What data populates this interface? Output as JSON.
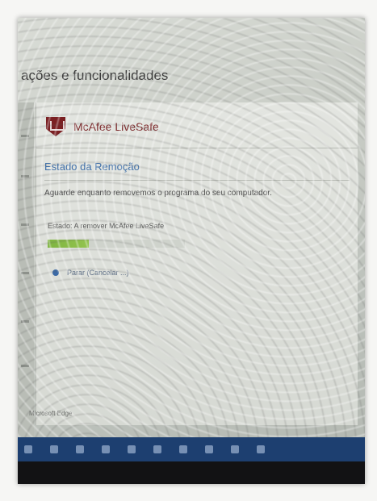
{
  "settings": {
    "title": "ações e funcionalidades"
  },
  "app": {
    "name": "McAfee LiveSafe",
    "brand_color": "#7a1f22"
  },
  "status": {
    "heading": "Estado da Remoção",
    "message": "Aguarde enquanto removemos o programa do seu computador.",
    "link_text": "",
    "progress_label": "Estado: A remover McAfee LiveSafe",
    "progress_fraction": 0.3,
    "cancel_label": "Parar (Cancelar ...)"
  },
  "taskbar": {
    "background": "#1d3f70",
    "icons": [
      "start-icon",
      "search-icon",
      "task-view-icon",
      "browser-icon",
      "folder-icon",
      "store-icon",
      "mail-icon",
      "app-icon",
      "app-icon",
      "app-icon"
    ]
  },
  "misc": {
    "bottom_left_text": "Microsoft Edge"
  }
}
